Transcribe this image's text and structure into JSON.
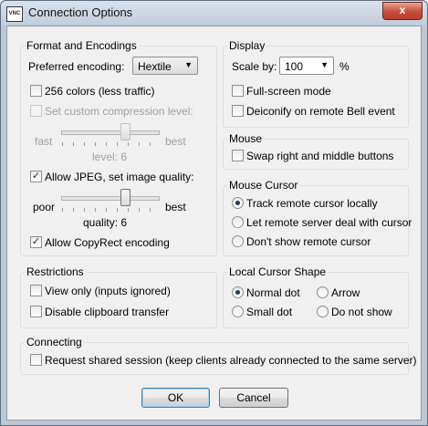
{
  "window": {
    "title": "Connection Options",
    "icon_text": "VNC",
    "close_label": "x"
  },
  "format": {
    "group_label": "Format and Encodings",
    "encoding_label": "Preferred encoding:",
    "encoding_value": "Hextile",
    "colors256_label": "256 colors (less traffic)",
    "colors256_checked": false,
    "compression_label": "Set custom compression level:",
    "compression_checked": false,
    "compression_fast": "fast",
    "compression_best": "best",
    "compression_level_text": "level: 6",
    "jpeg_label": "Allow JPEG, set image quality:",
    "jpeg_checked": true,
    "quality_poor": "poor",
    "quality_best": "best",
    "quality_text": "quality: 6",
    "copyrect_label": "Allow CopyRect encoding",
    "copyrect_checked": true
  },
  "display": {
    "group_label": "Display",
    "scale_label": "Scale by:",
    "scale_value": "100",
    "scale_unit": "%",
    "fullscreen_label": "Full-screen mode",
    "fullscreen_checked": false,
    "deiconify_label": "Deiconify on remote Bell event",
    "deiconify_checked": false
  },
  "mouse": {
    "group_label": "Mouse",
    "swap_label": "Swap right and middle buttons",
    "swap_checked": false
  },
  "mouse_cursor": {
    "group_label": "Mouse Cursor",
    "options": [
      {
        "label": "Track remote cursor locally",
        "selected": true
      },
      {
        "label": "Let remote server deal with cursor",
        "selected": false
      },
      {
        "label": "Don't show remote cursor",
        "selected": false
      }
    ]
  },
  "restrictions": {
    "group_label": "Restrictions",
    "view_only_label": "View only (inputs ignored)",
    "view_only_checked": false,
    "clipboard_label": "Disable clipboard transfer",
    "clipboard_checked": false
  },
  "local_cursor": {
    "group_label": "Local Cursor Shape",
    "options": [
      {
        "label": "Normal dot",
        "selected": true
      },
      {
        "label": "Arrow",
        "selected": false
      },
      {
        "label": "Small dot",
        "selected": false
      },
      {
        "label": "Do not show",
        "selected": false
      }
    ]
  },
  "connecting": {
    "group_label": "Connecting",
    "shared_label": "Request shared session (keep clients already connected to the same server)",
    "shared_checked": false
  },
  "buttons": {
    "ok": "OK",
    "cancel": "Cancel"
  },
  "icons": {
    "check_glyph": "✓",
    "dropdown_glyph": "▼"
  }
}
